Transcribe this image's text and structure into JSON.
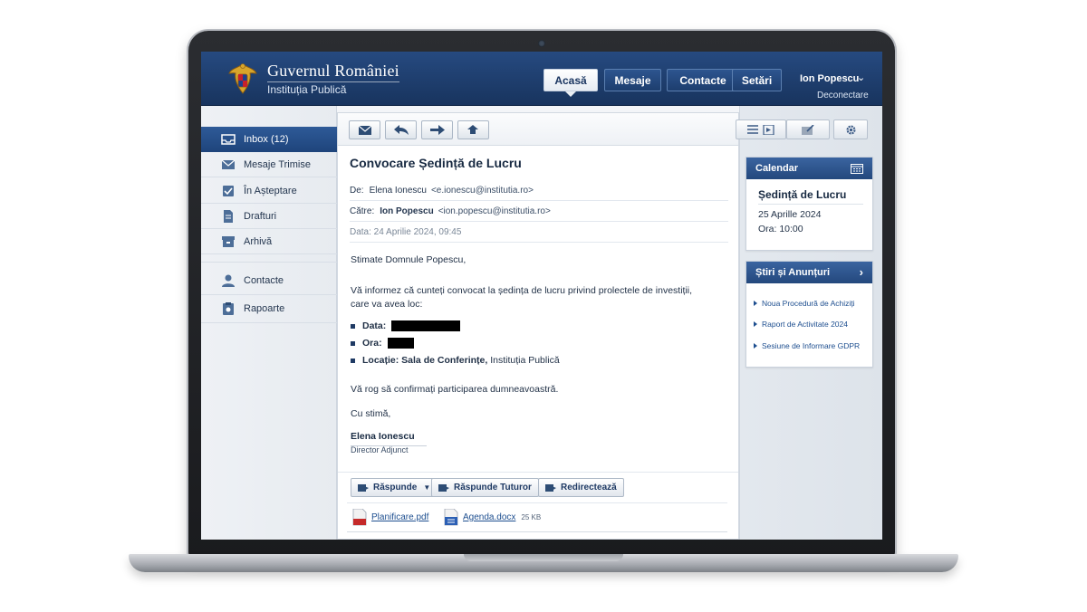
{
  "header": {
    "brand_title": "Guvernul României",
    "brand_subtitle": "Instituția Publică",
    "nav": [
      {
        "label": "Acasă",
        "active": true
      },
      {
        "label": "Mesaje",
        "active": false
      },
      {
        "label": "Contacte",
        "active": false
      },
      {
        "label": "Setări",
        "active": false
      }
    ],
    "user_name": "Ion Popescu",
    "logout_label": "Deconectare"
  },
  "sidebar": {
    "items": [
      {
        "label": "Inbox (12)",
        "icon": "inbox-icon",
        "active": true
      },
      {
        "label": "Mesaje Trimise",
        "icon": "envelope-icon",
        "active": false
      },
      {
        "label": "În Așteptare",
        "icon": "checkbox-icon",
        "active": false
      },
      {
        "label": "Drafturi",
        "icon": "document-icon",
        "active": false
      },
      {
        "label": "Arhivă",
        "icon": "archive-icon",
        "active": false
      },
      {
        "label": "Contacte",
        "icon": "person-icon",
        "active": false
      },
      {
        "label": "Rapoarte",
        "icon": "report-icon",
        "active": false
      }
    ]
  },
  "email": {
    "subject": "Convocare Ședință de Lucru",
    "from_label": "De:",
    "from_name": "Elena Ionescu",
    "from_address": "<e.ionescu@institutia.ro>",
    "to_label": "Către:",
    "to_name": "Ion Popescu",
    "to_address": "<ion.popescu@institutia.ro>",
    "date_line": "Data: 24 Aprilie 2024, 09:45",
    "greeting": "Stimate Domnule Popescu,",
    "intro_line1": "Vă informez că cunteți convocat la ședința de lucru privind prolectele de investiții,",
    "intro_line2": "care va avea loc:",
    "bullet_date_label": "Data:",
    "bullet_time_label": "Ora:",
    "bullet_location_label": "Locație: Sala de Conferințe,",
    "bullet_location_value": " Instituția Publică",
    "confirm_line": "Vă rog să confirmați participarea dumneavoastră.",
    "closing": "Cu stimă,",
    "signature_name": "Elena Ionescu",
    "signature_role": "Director Adjunct"
  },
  "actions": {
    "reply": "Răspunde",
    "reply_all": "Răspunde Tuturor",
    "forward": "Redirectează"
  },
  "attachments": [
    {
      "name": "Planificare.pdf",
      "size": "",
      "type": "pdf"
    },
    {
      "name": "Agenda.docx",
      "size": "25 KB",
      "type": "docx"
    }
  ],
  "calendar": {
    "heading": "Calendar",
    "event_title": "Ședință de Lucru",
    "event_date": "25 Aprille 2024",
    "event_time": "Ora: 10:00"
  },
  "news": {
    "heading": "Știri și Anunțuri",
    "items": [
      "Noua Procedură de Achiziți",
      "Raport de Activitate 2024",
      "Sesiune de Informare GDPR"
    ]
  },
  "colors": {
    "header": "#1e3e6c",
    "accent": "#2e5a98",
    "link": "#1d4e8f"
  }
}
